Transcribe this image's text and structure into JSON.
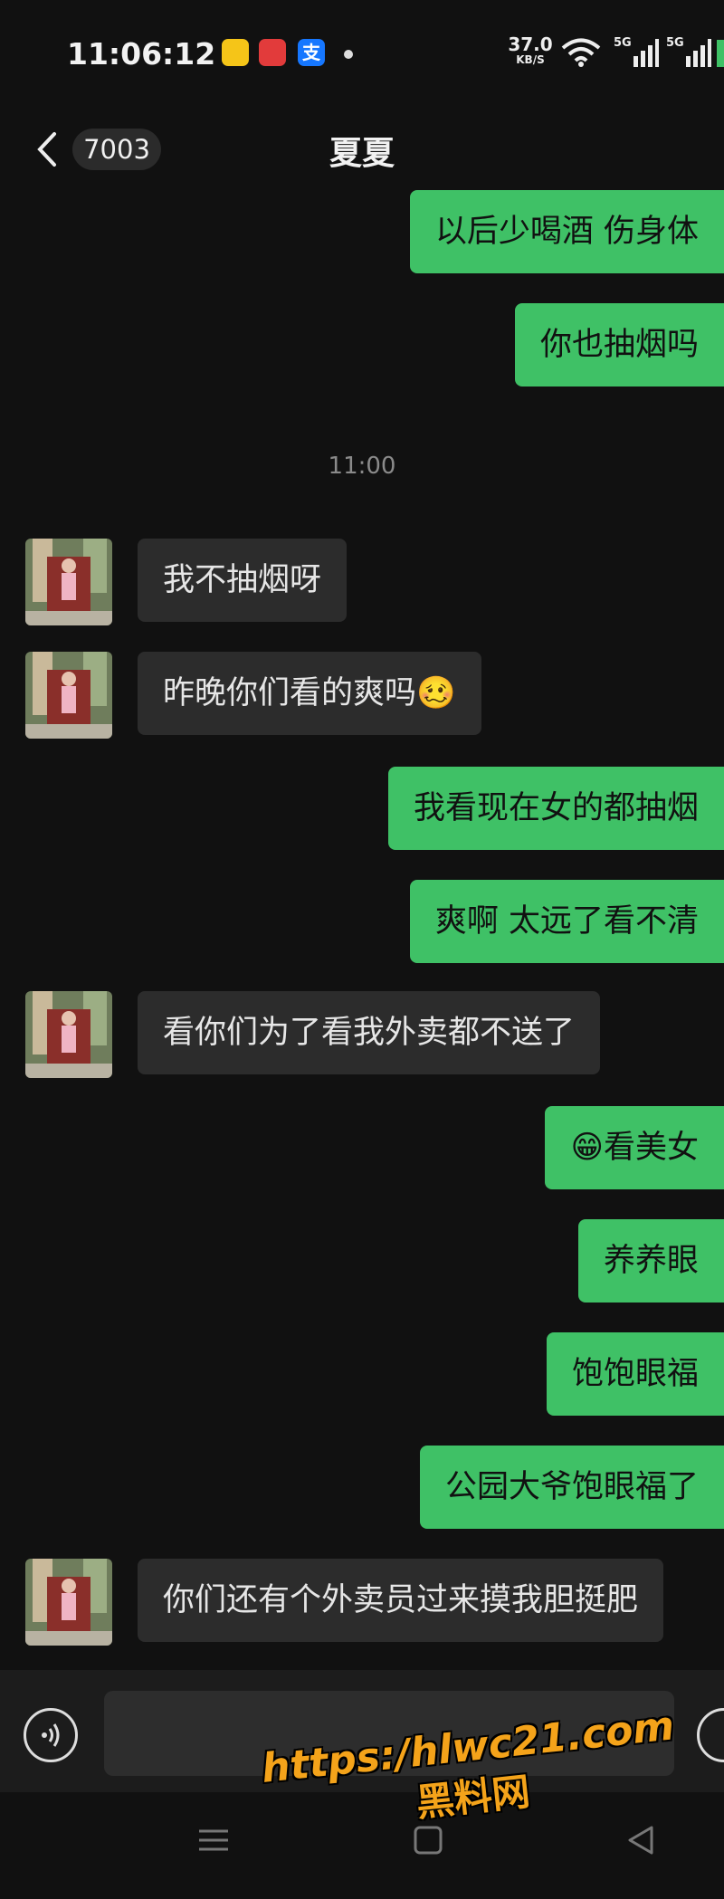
{
  "status_bar": {
    "time": "11:06:12",
    "net_speed_value": "37.0",
    "net_speed_unit": "KB/S",
    "signal_1": "5G",
    "signal_2": "5G",
    "icons": [
      "mango-app-icon",
      "app-red-icon",
      "alipay-icon",
      "wifi-icon",
      "signal-icon",
      "signal-icon",
      "battery-icon"
    ]
  },
  "header": {
    "unread_count": "7003",
    "contact_name": "夏夏"
  },
  "chat": {
    "timestamp": "11:00",
    "messages": [
      {
        "from": "me",
        "text": "以后少喝酒  伤身体"
      },
      {
        "from": "me",
        "text": "你也抽烟吗"
      },
      {
        "from": "them",
        "text": "我不抽烟呀"
      },
      {
        "from": "them",
        "text": "昨晚你们看的爽吗",
        "emoji": "🥴"
      },
      {
        "from": "me",
        "text": "我看现在女的都抽烟"
      },
      {
        "from": "me",
        "text": "爽啊  太远了看不清"
      },
      {
        "from": "them",
        "text": "看你们为了看我外卖都不送了"
      },
      {
        "from": "me",
        "text": "看美女",
        "emoji": "😁"
      },
      {
        "from": "me",
        "text": "养养眼"
      },
      {
        "from": "me",
        "text": "饱饱眼福"
      },
      {
        "from": "me",
        "text": "公园大爷饱眼福了"
      },
      {
        "from": "them",
        "text": "你们还有个外卖员过来摸我胆挺肥"
      }
    ]
  },
  "input": {
    "placeholder": "",
    "value": ""
  },
  "watermark": {
    "url": "https:/hlwc21.com",
    "name": "黑料网"
  },
  "colors": {
    "background": "#111111",
    "outgoing_bubble": "#3fc166",
    "incoming_bubble": "#2c2c2c",
    "watermark": "#f4a31a"
  }
}
